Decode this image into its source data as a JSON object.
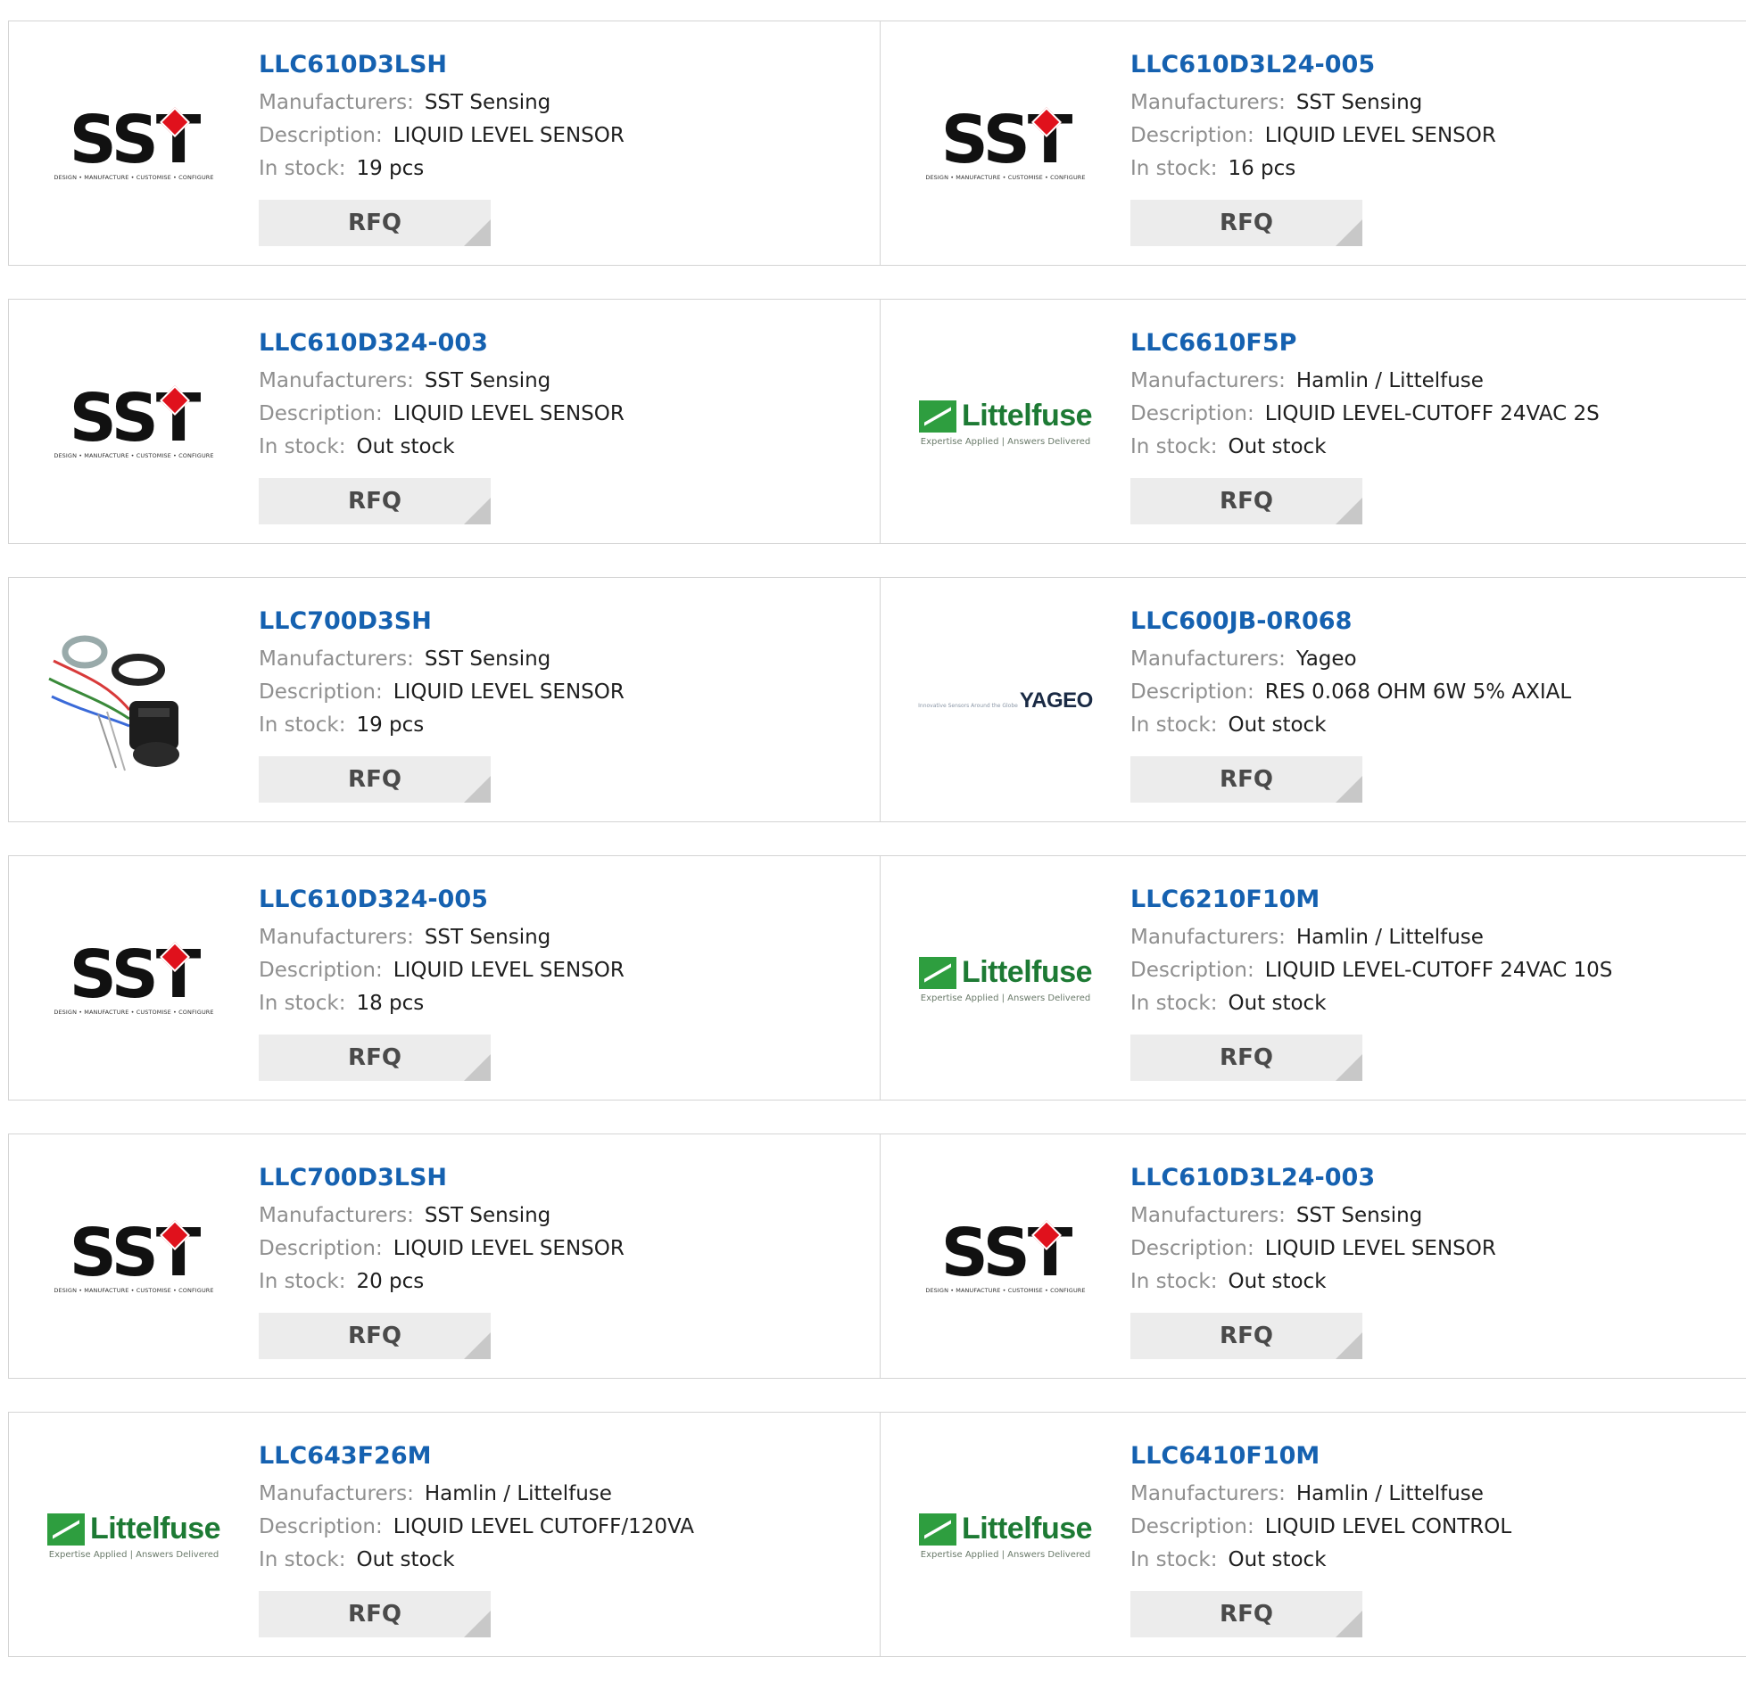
{
  "labels": {
    "manufacturer": "Manufacturers:",
    "description": "Description:",
    "stock": "In stock:",
    "rfq": "RFQ"
  },
  "logos": {
    "sst": {
      "word": "SST",
      "tagline": "DESIGN • MANUFACTURE • CUSTOMISE • CONFIGURE"
    },
    "littelfuse": {
      "word": "Littelfuse",
      "tagline": "Expertise Applied | Answers Delivered"
    },
    "yageo": {
      "word": "YAGEO",
      "tagline": "Innovative Sensors Around the Globe"
    }
  },
  "products": [
    {
      "pn": "LLC610D3LSH",
      "manufacturer": "SST Sensing",
      "description": "LIQUID LEVEL SENSOR",
      "stock": "19 pcs",
      "image": "sst-logo"
    },
    {
      "pn": "LLC610D3L24-005",
      "manufacturer": "SST Sensing",
      "description": "LIQUID LEVEL SENSOR",
      "stock": "16 pcs",
      "image": "sst-logo"
    },
    {
      "pn": "LLC610D324-003",
      "manufacturer": "SST Sensing",
      "description": "LIQUID LEVEL SENSOR",
      "stock": "Out stock",
      "image": "sst-logo"
    },
    {
      "pn": "LLC6610F5P",
      "manufacturer": "Hamlin / Littelfuse",
      "description": "LIQUID LEVEL-CUTOFF 24VAC 2S",
      "stock": "Out stock",
      "image": "littelfuse-logo"
    },
    {
      "pn": "LLC700D3SH",
      "manufacturer": "SST Sensing",
      "description": "LIQUID LEVEL SENSOR",
      "stock": "19 pcs",
      "image": "sensor-photo"
    },
    {
      "pn": "LLC600JB-0R068",
      "manufacturer": "Yageo",
      "description": "RES 0.068 OHM 6W 5% AXIAL",
      "stock": "Out stock",
      "image": "yageo-logo"
    },
    {
      "pn": "LLC610D324-005",
      "manufacturer": "SST Sensing",
      "description": "LIQUID LEVEL SENSOR",
      "stock": "18 pcs",
      "image": "sst-logo"
    },
    {
      "pn": "LLC6210F10M",
      "manufacturer": "Hamlin / Littelfuse",
      "description": "LIQUID LEVEL-CUTOFF 24VAC 10S",
      "stock": "Out stock",
      "image": "littelfuse-logo"
    },
    {
      "pn": "LLC700D3LSH",
      "manufacturer": "SST Sensing",
      "description": "LIQUID LEVEL SENSOR",
      "stock": "20 pcs",
      "image": "sst-logo"
    },
    {
      "pn": "LLC610D3L24-003",
      "manufacturer": "SST Sensing",
      "description": "LIQUID LEVEL SENSOR",
      "stock": "Out stock",
      "image": "sst-logo"
    },
    {
      "pn": "LLC643F26M",
      "manufacturer": "Hamlin / Littelfuse",
      "description": "LIQUID LEVEL CUTOFF/120VA",
      "stock": "Out stock",
      "image": "littelfuse-logo"
    },
    {
      "pn": "LLC6410F10M",
      "manufacturer": "Hamlin / Littelfuse",
      "description": "LIQUID LEVEL CONTROL",
      "stock": "Out stock",
      "image": "littelfuse-logo"
    }
  ],
  "colors": {
    "part_number": "#1561b0",
    "label": "#8f8f8f",
    "value": "#1e1e1e",
    "button_bg": "#ececec",
    "sst_red": "#e0111c",
    "littelfuse_green": "#2e9e3f"
  }
}
